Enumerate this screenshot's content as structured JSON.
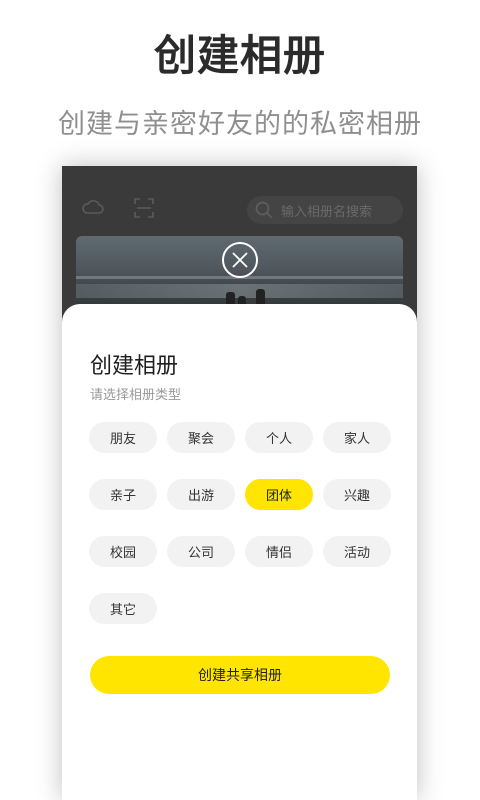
{
  "hero": {
    "title": "创建相册",
    "subtitle": "创建与亲密好友的的私密相册"
  },
  "app_topbar": {
    "search_placeholder": "输入相册名搜索"
  },
  "sheet": {
    "title": "创建相册",
    "subtitle": "请选择相册类型",
    "types": [
      {
        "label": "朋友",
        "selected": false
      },
      {
        "label": "聚会",
        "selected": false
      },
      {
        "label": "个人",
        "selected": false
      },
      {
        "label": "家人",
        "selected": false
      },
      {
        "label": "亲子",
        "selected": false
      },
      {
        "label": "出游",
        "selected": false
      },
      {
        "label": "团体",
        "selected": true
      },
      {
        "label": "兴趣",
        "selected": false
      },
      {
        "label": "校园",
        "selected": false
      },
      {
        "label": "公司",
        "selected": false
      },
      {
        "label": "情侣",
        "selected": false
      },
      {
        "label": "活动",
        "selected": false
      },
      {
        "label": "其它",
        "selected": false
      }
    ],
    "create_button_label": "创建共享相册"
  },
  "colors": {
    "accent": "#ffe500",
    "chip_bg": "#f2f2f2",
    "overlay": "#3a3a3a"
  },
  "icons": {
    "topbar_left": "cloud-icon",
    "topbar_second": "scan-icon",
    "search": "search-icon",
    "close": "close-icon"
  }
}
